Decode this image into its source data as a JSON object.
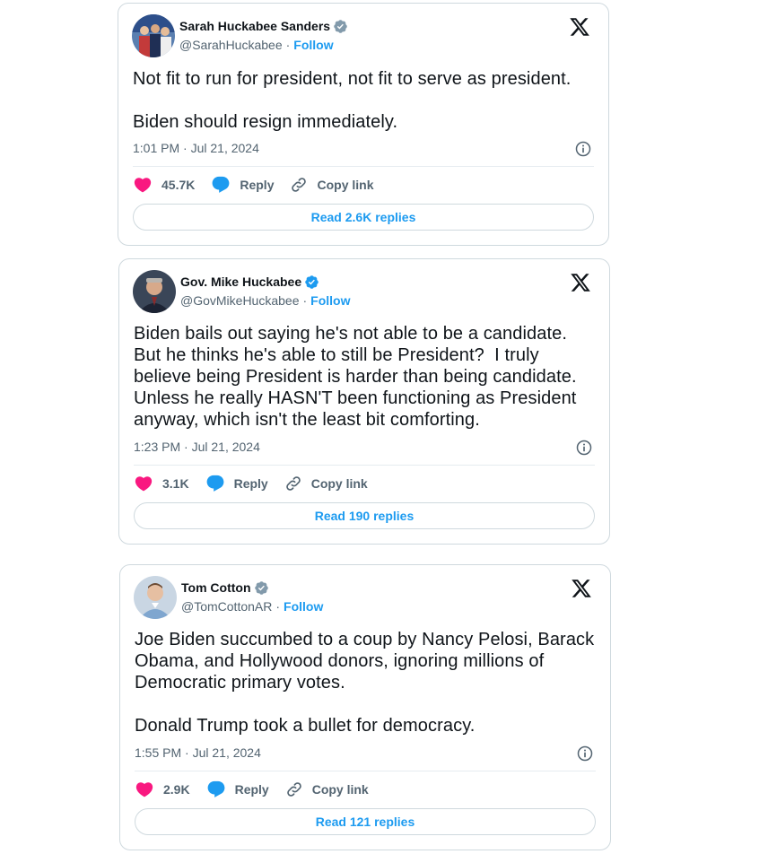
{
  "tweets": [
    {
      "name": "Sarah Huckabee Sanders",
      "handle": "@SarahHuckabee",
      "follow_label": "Follow",
      "verified_color": "#829aab",
      "text": "Not fit to run for president, not fit to serve as president.\n\nBiden should resign immediately.",
      "timestamp": "1:01 PM · Jul 21, 2024",
      "likes": "45.7K",
      "reply_label": "Reply",
      "copy_label": "Copy link",
      "read_replies": "Read 2.6K replies"
    },
    {
      "name": "Gov. Mike Huckabee",
      "handle": "@GovMikeHuckabee",
      "follow_label": "Follow",
      "verified_color": "#1d9bf0",
      "text": "Biden bails out saying he's not able to be a candidate.\nBut he thinks he's able to still be President?  I truly believe being President is harder than being candidate.  Unless he really HASN'T been functioning as President anyway, which isn't the least bit comforting.",
      "timestamp": "1:23 PM · Jul 21, 2024",
      "likes": "3.1K",
      "reply_label": "Reply",
      "copy_label": "Copy link",
      "read_replies": "Read 190 replies"
    },
    {
      "name": "Tom Cotton",
      "handle": "@TomCottonAR",
      "follow_label": "Follow",
      "verified_color": "#829aab",
      "text": "Joe Biden succumbed to a coup by Nancy Pelosi, Barack Obama, and Hollywood donors, ignoring millions of Democratic primary votes.\n\nDonald Trump took a bullet for democracy.",
      "timestamp": "1:55 PM · Jul 21, 2024",
      "likes": "2.9K",
      "reply_label": "Reply",
      "copy_label": "Copy link",
      "read_replies": "Read 121 replies"
    }
  ],
  "colors": {
    "accent": "#1d9bf0",
    "like": "#f91880",
    "muted": "#536471",
    "border": "#cfd9de"
  },
  "icons": [
    "x-logo-icon",
    "verified-badge-icon",
    "info-icon",
    "heart-icon",
    "reply-bubble-icon",
    "link-icon"
  ]
}
